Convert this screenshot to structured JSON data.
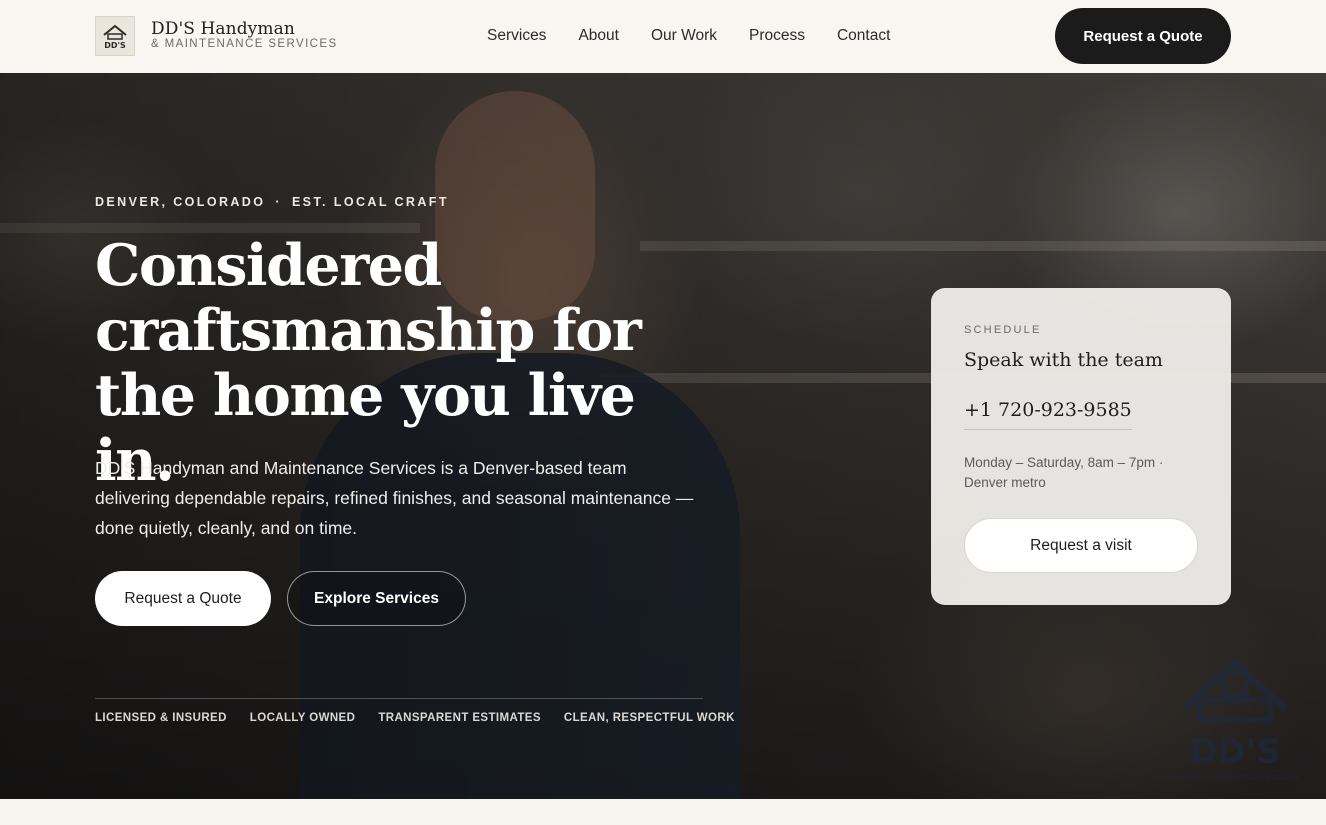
{
  "header": {
    "brand_name": "DD'S Handyman",
    "brand_tagline": "& MAINTENANCE SERVICES",
    "logo_text": "DD'S",
    "nav": [
      "Services",
      "About",
      "Our Work",
      "Process",
      "Contact"
    ],
    "cta_label": "Request a Quote"
  },
  "hero": {
    "eyebrow_location": "DENVER, COLORADO",
    "eyebrow_separator": "·",
    "eyebrow_tag": "EST. LOCAL CRAFT",
    "title": "Considered craftsmanship for the home you live in.",
    "subtitle": "DD'S Handyman and Maintenance Services is a Denver-based team delivering dependable repairs, refined finishes, and seasonal maintenance — done quietly, cleanly, and on time.",
    "primary_button": "Request a Quote",
    "secondary_button": "Explore Services",
    "trust_items": [
      "LICENSED & INSURED",
      "LOCALLY OWNED",
      "TRANSPARENT ESTIMATES",
      "CLEAN, RESPECTFUL WORK"
    ]
  },
  "schedule_card": {
    "eyebrow": "SCHEDULE",
    "title": "Speak with the team",
    "phone": "+1 720-923-9585",
    "hours": "Monday – Saturday, 8am – 7pm · Denver metro",
    "button": "Request a visit"
  },
  "watermark": {
    "text": "DD'S",
    "subtext": "HANDYMAN AND MAINTENANCE SERVICES"
  },
  "colors": {
    "header_bg": "#f8f6f1",
    "dark_button": "#1b1b1b",
    "hero_text": "#ffffff",
    "card_bg": "#f0eeea"
  }
}
